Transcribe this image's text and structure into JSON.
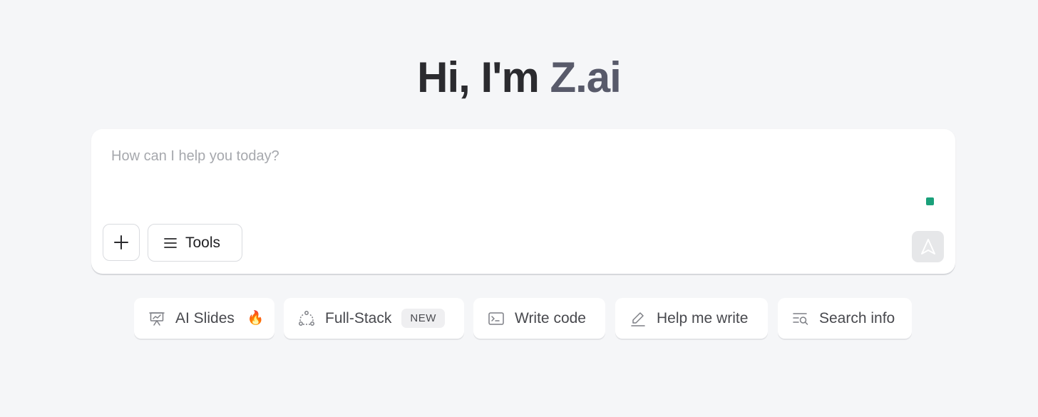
{
  "hero": {
    "greeting": "Hi, I'm ",
    "brand": "Z.ai"
  },
  "composer": {
    "placeholder": "How can I help you today?",
    "tools_label": "Tools",
    "icons": {
      "attach": "plus-icon",
      "tools": "menu-icon",
      "send": "send-arrow-icon"
    },
    "status_color": "#1aa07a"
  },
  "chips": [
    {
      "label": "AI Slides",
      "icon": "presentation-icon",
      "suffix": "🔥"
    },
    {
      "label": "Full-Stack",
      "icon": "nodes-icon",
      "badge": "NEW"
    },
    {
      "label": "Write code",
      "icon": "terminal-icon"
    },
    {
      "label": "Help me write",
      "icon": "pencil-icon"
    },
    {
      "label": "Search info",
      "icon": "search-list-icon"
    }
  ],
  "colors": {
    "background": "#f5f6f8",
    "title": "#2b2b2f",
    "brand": "#585a6a",
    "accent": "#1aa07a"
  }
}
